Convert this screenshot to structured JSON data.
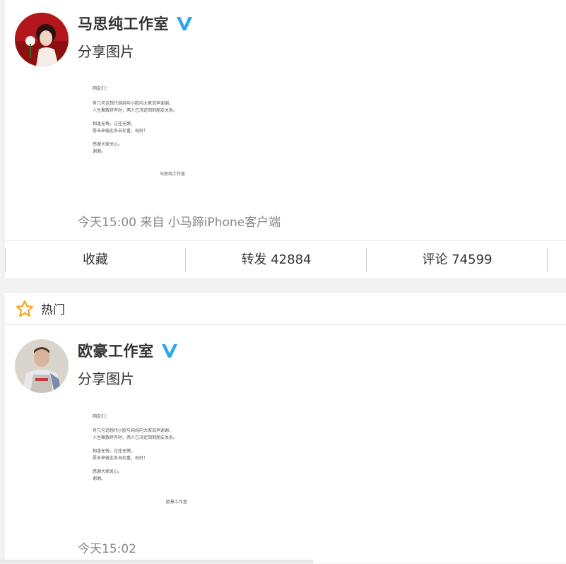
{
  "posts": [
    {
      "author": "马思纯工作室",
      "text": "分享图片",
      "doc_lines": [
        "网友们：",
        "有几句话想代纯纯与小欧向大家说声谢谢。",
        "人生聚散终有时，两人已决定回到朋友关系。",
        "相逢无悔，过往无憾。",
        "愿未来彼此各自珍重，祝好！",
        "感谢大家关心。",
        "谢谢。",
        "马思纯工作室"
      ],
      "meta": "今天15:00 来自 小马蹄iPhone客户端"
    },
    {
      "author": "欧豪工作室",
      "text": "分享图片",
      "doc_lines": [
        "网友们：",
        "有几句话想代小欧与纯纯向大家说声谢谢。",
        "人生聚散终有时，两人已决定回到朋友关系。",
        "相逢无悔，过往无憾。",
        "愿未来彼此各自珍重，祝好！",
        "感谢大家关心。",
        "谢谢。",
        "欧豪工作室"
      ],
      "meta": "今天15:02"
    }
  ],
  "actions": {
    "favorite": "收藏",
    "repost": "转发 42884",
    "comment": "评论 74599"
  },
  "hot_section": {
    "label": "热门"
  },
  "colors": {
    "verified": "#2aa7f0",
    "star": "#f5a623",
    "meta": "#888888"
  },
  "icons": [
    "verified-icon",
    "star-icon"
  ]
}
